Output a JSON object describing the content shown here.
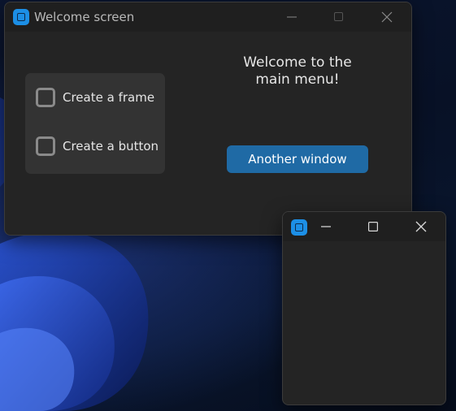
{
  "main_window": {
    "title": "Welcome screen",
    "checkboxes": [
      {
        "label": "Create a frame",
        "checked": false
      },
      {
        "label": "Create a button",
        "checked": false
      }
    ],
    "welcome_line1": "Welcome to the",
    "welcome_line2": "main menu!",
    "another_window_button": "Another window"
  },
  "second_window": {
    "title": ""
  },
  "colors": {
    "window_bg": "#242424",
    "titlebar_bg": "#1f1f1f",
    "frame_bg": "#333333",
    "accent_button": "#1f6aa5",
    "app_icon": "#1c8fe6"
  },
  "icons": {
    "app": "app-icon",
    "minimize": "minimize-icon",
    "maximize": "maximize-icon",
    "close": "close-icon"
  }
}
